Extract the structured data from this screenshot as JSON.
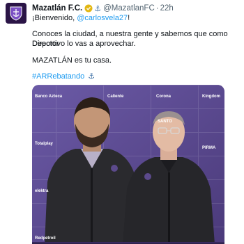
{
  "tweet": {
    "author_name": "Mazatlán F.C.",
    "handle": "@MazatlanFC",
    "separator": "·",
    "time": "22h",
    "anchor_emoji": "⚓",
    "line1_prefix": "¡Bienvenido, ",
    "mention": "@carlosvela27",
    "line1_suffix": "!",
    "paragraph1_line1": "Conoces la ciudad, a nuestra gente y sabemos que como Director",
    "paragraph1_line2": "Deportivo lo vas a aprovechar.",
    "paragraph2": "MAZATLÁN es tu casa.",
    "hashtag": "#ARRebatando",
    "hashtag_emoji": "⚓"
  },
  "photo": {
    "backdrop_logos": [
      "Banco Azteca",
      "Caliente",
      "Kingdom",
      "Totalplay",
      "Corona",
      "SANTO",
      "PIRMA",
      "elektra",
      "Redpetroil"
    ]
  },
  "colors": {
    "link": "#1d9bf0",
    "handle_gray": "#536471",
    "backdrop_purple": "#5a4a8a",
    "jacket": "#2a2a2e"
  },
  "icons": {
    "avatar": "mazatlan-shield-logo",
    "verified": "verified-badge-icon"
  }
}
